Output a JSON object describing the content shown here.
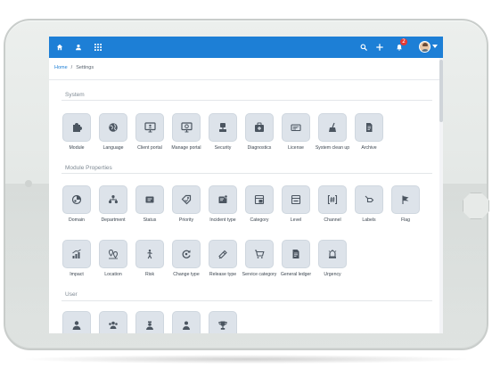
{
  "topbar": {
    "accent_color": "#1d7fd6",
    "left_icons": [
      "home-icon",
      "user-icon",
      "apps-grid-icon"
    ],
    "right_icons": [
      "search-icon",
      "plus-icon",
      "bell-icon",
      "avatar"
    ],
    "notification_count": "2"
  },
  "breadcrumb": {
    "home": "Home",
    "separator": "/",
    "current": "Settings"
  },
  "sections": {
    "system": {
      "title": "System",
      "items": [
        {
          "label": "Module",
          "icon": "module-icon"
        },
        {
          "label": "Language",
          "icon": "language-icon"
        },
        {
          "label": "Client portal",
          "icon": "client-portal-icon"
        },
        {
          "label": "Manage portal",
          "icon": "manage-portal-icon"
        },
        {
          "label": "Security",
          "icon": "security-icon"
        },
        {
          "label": "Diagnostics",
          "icon": "diagnostics-icon"
        },
        {
          "label": "License",
          "icon": "license-icon"
        },
        {
          "label": "System clean up",
          "icon": "cleanup-icon"
        },
        {
          "label": "Archive",
          "icon": "archive-icon"
        }
      ]
    },
    "module_properties": {
      "title": "Module Properties",
      "items": [
        {
          "label": "Domain",
          "icon": "domain-icon"
        },
        {
          "label": "Department",
          "icon": "department-icon"
        },
        {
          "label": "Status",
          "icon": "status-icon"
        },
        {
          "label": "Priority",
          "icon": "priority-icon"
        },
        {
          "label": "Incident type",
          "icon": "incident-type-icon"
        },
        {
          "label": "Category",
          "icon": "category-icon"
        },
        {
          "label": "Level",
          "icon": "level-icon"
        },
        {
          "label": "Channel",
          "icon": "channel-icon"
        },
        {
          "label": "Labels",
          "icon": "labels-icon"
        },
        {
          "label": "Flag",
          "icon": "flag-icon"
        },
        {
          "label": "Impact",
          "icon": "impact-icon"
        },
        {
          "label": "Location",
          "icon": "location-icon"
        },
        {
          "label": "Risk",
          "icon": "risk-icon"
        },
        {
          "label": "Change type",
          "icon": "change-type-icon"
        },
        {
          "label": "Release type",
          "icon": "release-type-icon"
        },
        {
          "label": "Service category",
          "icon": "service-category-icon"
        },
        {
          "label": "General ledger",
          "icon": "general-ledger-icon"
        },
        {
          "label": "Urgency",
          "icon": "urgency-icon"
        }
      ]
    },
    "user": {
      "title": "User",
      "items": [
        {
          "icon": "user-icon"
        },
        {
          "icon": "user-group-icon"
        },
        {
          "icon": "user-role-icon"
        },
        {
          "icon": "user-profile-icon"
        },
        {
          "icon": "trophy-icon"
        }
      ]
    }
  }
}
